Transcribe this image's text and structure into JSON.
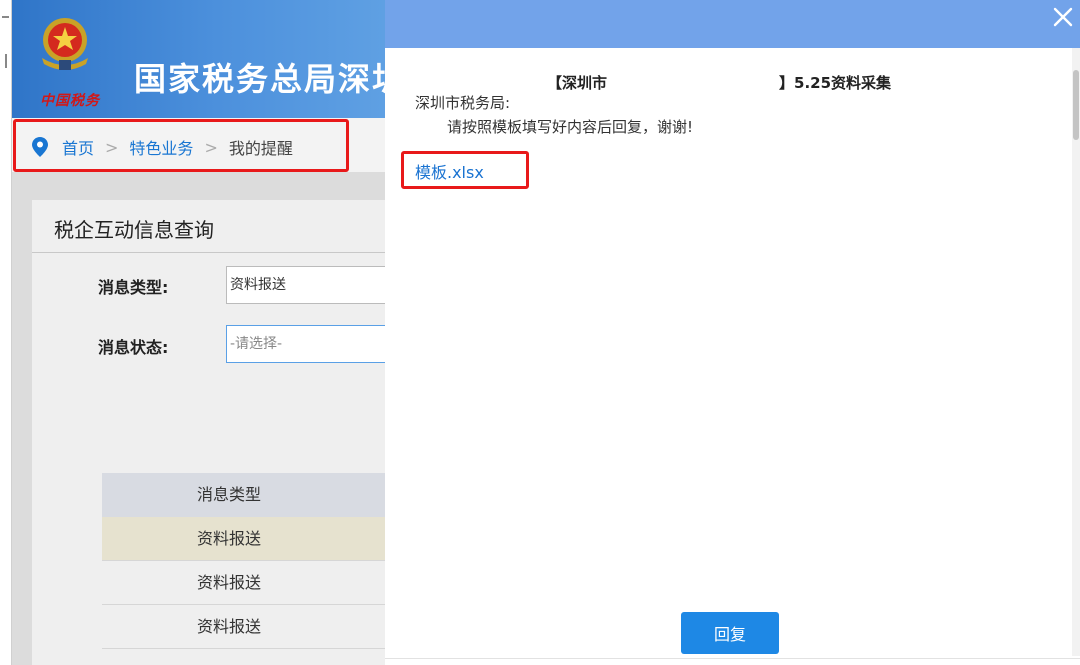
{
  "site": {
    "emblem_text": "中国税务",
    "title": "国家税务总局深圳"
  },
  "breadcrumb": {
    "home": "首页",
    "section": "特色业务",
    "current": "我的提醒",
    "separator": ">"
  },
  "panel": {
    "title": "税企互动信息查询",
    "fields": {
      "msg_type_label": "消息类型:",
      "msg_type_value": "资料报送",
      "msg_status_label": "消息状态:",
      "msg_status_placeholder": "-请选择-"
    },
    "table": {
      "header": "消息类型",
      "rows": [
        "资料报送",
        "资料报送",
        "资料报送"
      ]
    }
  },
  "modal": {
    "title_prefix": "【深圳市",
    "title_suffix": "】5.25资料采集",
    "greeting": "深圳市税务局:",
    "body": "请按照模板填写好内容后回复，谢谢!",
    "attachment": "模板.xlsx",
    "reply_label": "回复"
  },
  "colors": {
    "modal_header": "#72a3ea",
    "link": "#1a73d1",
    "reply_button": "#1e88e5",
    "highlight_border": "#e8191a",
    "banner": "#2f75c8"
  },
  "icons": {
    "close": "close-icon",
    "location": "location-pin-icon",
    "emblem": "tax-emblem-icon"
  }
}
